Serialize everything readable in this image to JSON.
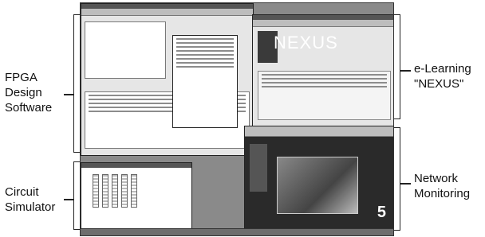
{
  "labels": {
    "fpga": "FPGA\nDesign\nSoftware",
    "circuit": "Circuit\nSimulator",
    "elearning": "e-Learning\n\"NEXUS\"",
    "network": "Network\nMonitoring"
  },
  "screen": {
    "nexus_logo_text": "NEXUS",
    "corner_number": "5"
  }
}
